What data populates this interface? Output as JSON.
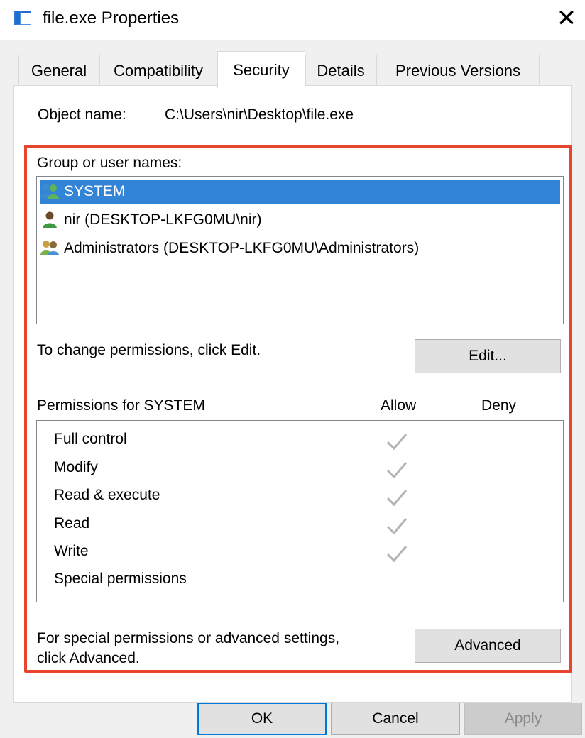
{
  "window": {
    "title": "file.exe Properties",
    "close_glyph": "✕",
    "icon": "window-icon"
  },
  "tabs": [
    {
      "label": "General"
    },
    {
      "label": "Compatibility"
    },
    {
      "label": "Security",
      "active": true
    },
    {
      "label": "Details"
    },
    {
      "label": "Previous Versions"
    }
  ],
  "object": {
    "label": "Object name:",
    "value": "C:\\Users\\nir\\Desktop\\file.exe"
  },
  "groups": {
    "label": "Group or user names:",
    "items": [
      {
        "label": "SYSTEM",
        "icon": "users-group-icon",
        "selected": true
      },
      {
        "label": "nir (DESKTOP-LKFG0MU\\nir)",
        "icon": "user-icon",
        "selected": false
      },
      {
        "label": "Administrators (DESKTOP-LKFG0MU\\Administrators)",
        "icon": "users-group-icon",
        "selected": false
      }
    ]
  },
  "edit": {
    "text": "To change permissions, click Edit.",
    "button": "Edit..."
  },
  "permissions": {
    "header": "Permissions for SYSTEM",
    "allow_label": "Allow",
    "deny_label": "Deny",
    "rows": [
      {
        "label": "Full control",
        "allow": true,
        "deny": false
      },
      {
        "label": "Modify",
        "allow": true,
        "deny": false
      },
      {
        "label": "Read & execute",
        "allow": true,
        "deny": false
      },
      {
        "label": "Read",
        "allow": true,
        "deny": false
      },
      {
        "label": "Write",
        "allow": true,
        "deny": false
      },
      {
        "label": "Special permissions",
        "allow": false,
        "deny": false
      }
    ]
  },
  "advanced": {
    "text_line1": "For special permissions or advanced settings,",
    "text_line2": "click Advanced.",
    "button": "Advanced"
  },
  "buttons": {
    "ok": "OK",
    "cancel": "Cancel",
    "apply": "Apply"
  },
  "colors": {
    "highlight": "#3284d6",
    "annotation_border": "#e8452f",
    "checkmark": "#b4b4b4"
  }
}
